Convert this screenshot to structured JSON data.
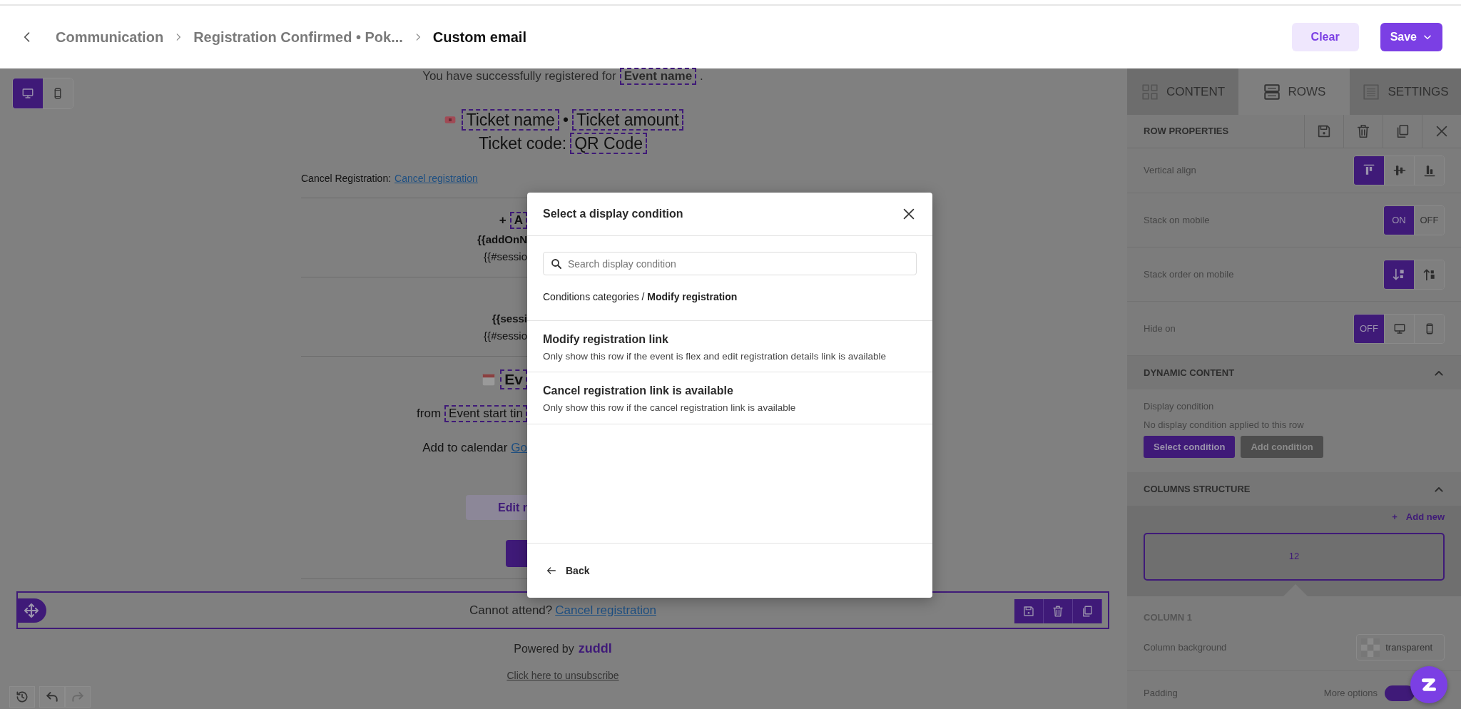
{
  "header": {
    "breadcrumbs": [
      {
        "label": "Communication",
        "current": false
      },
      {
        "label": "Registration Confirmed • Pok...",
        "current": false
      },
      {
        "label": "Custom email",
        "current": true
      }
    ],
    "clear_button": "Clear",
    "save_button": "Save"
  },
  "device_toggle": [
    {
      "kind": "desktop",
      "selected": true
    },
    {
      "kind": "mobile",
      "selected": false
    }
  ],
  "email": {
    "rows": [
      {
        "kind": "intro",
        "text": "You have successfully registered for",
        "tag": "Event name",
        "end": "."
      },
      {
        "kind": "ticket",
        "tag": "Ticket name",
        "sep": "•",
        "tag2": "Ticket amount"
      },
      {
        "kind": "code",
        "text": "Ticket code:",
        "tag": "QR Code"
      },
      {
        "kind": "cancel",
        "text": "Cancel Registration:",
        "link": "Cancel registration"
      },
      {
        "kind": "divider"
      },
      {
        "kind": "tagline",
        "text": "+",
        "tag": "A"
      },
      {
        "kind": "bold",
        "text": "{{addOnN"
      },
      {
        "kind": "plain",
        "text": "{{#sessio"
      },
      {
        "kind": "divider"
      },
      {
        "kind": "bold",
        "text": "{{sessi"
      },
      {
        "kind": "plain",
        "text": "{{#sessio"
      },
      {
        "kind": "divider"
      },
      {
        "kind": "event",
        "tag": "Ev"
      },
      {
        "kind": "from",
        "text": "from",
        "tag": "Event start tin"
      },
      {
        "kind": "calendar",
        "text": "Add to calendar",
        "link": "Go"
      },
      {
        "kind": "soft-button",
        "text": "Edit r"
      },
      {
        "kind": "button"
      },
      {
        "kind": "divider"
      }
    ],
    "footer_row": {
      "text": "Cannot attend?",
      "link": "Cancel registration",
      "selected": true
    },
    "powered": {
      "text": "Powered by",
      "brand": "zuddl"
    },
    "unsubscribe": "Click here to unsubscribe"
  },
  "modal": {
    "title": "Select a display condition",
    "search": {
      "placeholder": "Search display condition"
    },
    "path": "Conditions categories / **Modify registration**",
    "options": [
      {
        "title": "Modify registration link",
        "description": "Only show this row if the event is flex and edit registration details link is available"
      },
      {
        "title": "Cancel registration link is available",
        "description": "Only show this row if the cancel registration link is available"
      }
    ],
    "back": "Back"
  },
  "panel": {
    "tabs": [
      {
        "kind": "content",
        "label": "CONTENT",
        "selected": false
      },
      {
        "kind": "rows",
        "label": "ROWS",
        "selected": true
      },
      {
        "kind": "settings",
        "label": "SETTINGS",
        "selected": false
      }
    ],
    "title": "ROW PROPERTIES",
    "settings": [
      {
        "label": "Vertical align",
        "options": [
          {
            "kind": "align-top",
            "selected": true
          },
          {
            "kind": "align-middle",
            "selected": false
          },
          {
            "kind": "align-bottom",
            "selected": false
          }
        ]
      },
      {
        "label": "Stack on mobile",
        "options": [
          {
            "label": "ON",
            "selected": true
          },
          {
            "label": "OFF",
            "selected": false
          }
        ]
      },
      {
        "label": "Stack order on mobile",
        "options": [
          {
            "kind": "stack-down",
            "selected": true
          },
          {
            "kind": "stack-up",
            "selected": false
          }
        ]
      },
      {
        "label": "Hide on",
        "options": [
          {
            "label": "OFF",
            "selected": true
          },
          {
            "kind": "desktop",
            "selected": false
          },
          {
            "kind": "mobile",
            "selected": false
          }
        ]
      }
    ],
    "dynamic": {
      "title": "DYNAMIC CONTENT",
      "expanded": true,
      "label": "Display condition",
      "note": "No display condition applied to this row",
      "buttons": [
        {
          "kind": "primary",
          "label": "Select condition"
        },
        {
          "kind": "secondary",
          "label": "Add condition"
        }
      ]
    },
    "columns": {
      "title": "COLUMNS STRUCTURE",
      "expanded": true,
      "add_icon": "+",
      "add_label": "Add new",
      "items": [
        {
          "label": "12",
          "selected": true
        }
      ]
    },
    "column": {
      "title": "COLUMN 1",
      "background_label": "Column background",
      "background_value": "transparent",
      "padding_label": "Padding",
      "more_label": "More options",
      "more_on": true
    }
  }
}
